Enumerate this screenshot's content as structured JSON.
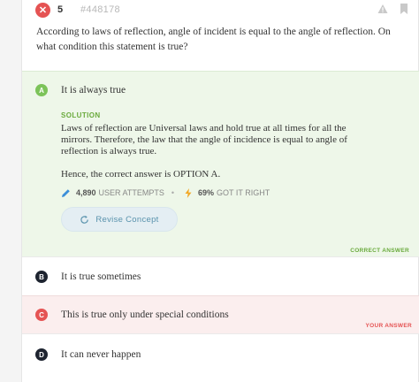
{
  "header": {
    "question_number": "5",
    "question_id": "#448178"
  },
  "question": {
    "text": "According to laws of reflection, angle of incident is equal to the angle of reflection. On what condition this statement is true?"
  },
  "options": [
    {
      "letter": "A",
      "text": "It is always true"
    },
    {
      "letter": "B",
      "text": "It is true sometimes"
    },
    {
      "letter": "C",
      "text": "This is true only under special conditions"
    },
    {
      "letter": "D",
      "text": "It can never happen"
    }
  ],
  "solution": {
    "label": "SOLUTION",
    "body": "Laws of reflection are Universal laws and hold true at all times for all the mirrors. Therefore, the law that the angle of incidence is equal to angle of reflection is always true.",
    "answer_line": "Hence, the correct answer is OPTION A.",
    "attempts_count": "4,890",
    "attempts_label": "USER ATTEMPTS",
    "separator": "•",
    "got_right_percent": "69%",
    "got_right_label": "GOT IT RIGHT",
    "revise_label": "Revise Concept"
  },
  "tags": {
    "correct": "CORRECT ANSWER",
    "yours": "YOUR ANSWER"
  },
  "colors": {
    "correct_green": "#7cc359",
    "wrong_red": "#e55353",
    "neutral_dark": "#1e2430",
    "revise_blue": "#5a93ad"
  }
}
